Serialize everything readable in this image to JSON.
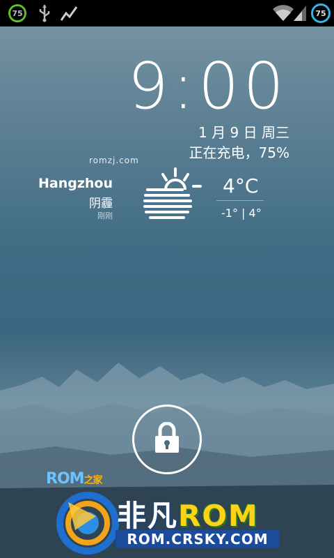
{
  "status_bar": {
    "left_battery": "75",
    "right_battery": "75",
    "icons": [
      "battery-ring-icon",
      "usb-icon",
      "activity-icon",
      "wifi-icon",
      "signal-icon",
      "battery-ring-icon"
    ]
  },
  "lockscreen": {
    "time": "9:00",
    "date": "1 月 9 日 周三",
    "charging": "正在充电，75%",
    "watermark": "romzj.com"
  },
  "weather": {
    "city": "Hangzhou",
    "condition": "阴霾",
    "updated": "刚刚",
    "temperature": "4°C",
    "range": "-1° | 4°",
    "icon": "haze-sun-icon"
  },
  "lock": {
    "icon": "lock-icon"
  },
  "branding": {
    "rom_home_main": "ROM",
    "rom_home_sub": "之家",
    "brand_cn": "非凡",
    "brand_rom": "ROM",
    "brand_url": "ROM.CRSKY.COM"
  },
  "colors": {
    "status_bg": "#000000",
    "battery_green": "#5fbf2a",
    "battery_blue": "#33b5e5"
  }
}
